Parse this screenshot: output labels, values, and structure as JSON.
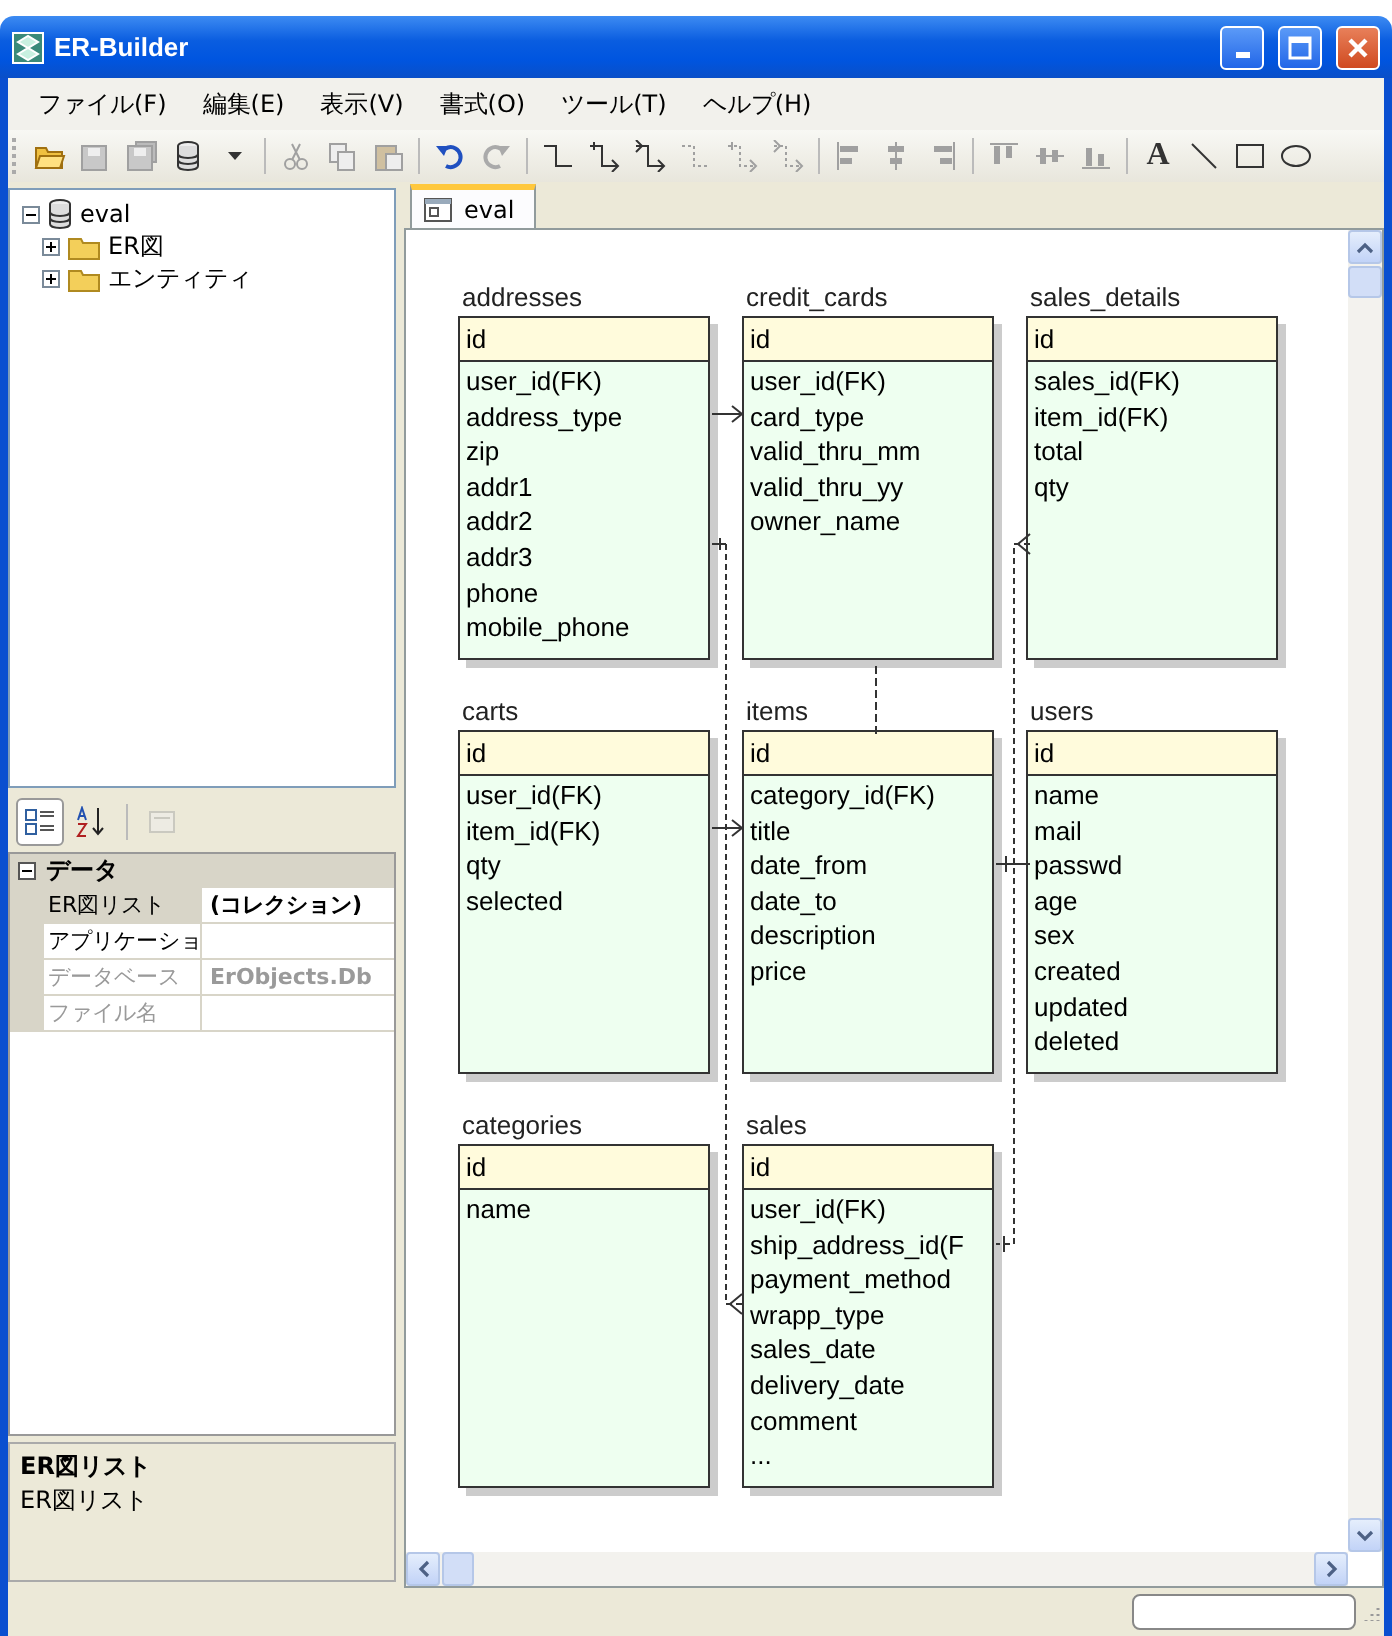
{
  "window": {
    "title": "ER-Builder"
  },
  "menu": [
    "ファイル(F)",
    "編集(E)",
    "表示(V)",
    "書式(O)",
    "ツール(T)",
    "ヘルプ(H)"
  ],
  "toolbar": [
    {
      "kind": "open",
      "disabled": false
    },
    {
      "kind": "save",
      "disabled": true
    },
    {
      "kind": "save-all",
      "disabled": true
    },
    {
      "kind": "database",
      "disabled": false
    },
    {
      "kind": "dropdown",
      "disabled": false
    },
    {
      "kind": "sep"
    },
    {
      "kind": "cut",
      "disabled": true
    },
    {
      "kind": "copy",
      "disabled": true
    },
    {
      "kind": "paste",
      "disabled": true
    },
    {
      "kind": "sep"
    },
    {
      "kind": "undo",
      "disabled": false
    },
    {
      "kind": "redo",
      "disabled": true
    },
    {
      "kind": "sep"
    },
    {
      "kind": "connector",
      "disabled": false
    },
    {
      "kind": "connector-many",
      "disabled": false
    },
    {
      "kind": "connector-arrow",
      "disabled": false
    },
    {
      "kind": "connector",
      "disabled": true
    },
    {
      "kind": "connector-many",
      "disabled": true
    },
    {
      "kind": "connector-arrow",
      "disabled": true
    },
    {
      "kind": "sep"
    },
    {
      "kind": "align-left",
      "disabled": true
    },
    {
      "kind": "align-center",
      "disabled": true
    },
    {
      "kind": "align-right",
      "disabled": true
    },
    {
      "kind": "sep"
    },
    {
      "kind": "align-top",
      "disabled": true
    },
    {
      "kind": "align-middle",
      "disabled": true
    },
    {
      "kind": "align-bottom",
      "disabled": true
    },
    {
      "kind": "sep"
    },
    {
      "kind": "text",
      "label": "A",
      "disabled": false
    },
    {
      "kind": "line",
      "disabled": false
    },
    {
      "kind": "rectangle",
      "disabled": false
    },
    {
      "kind": "ellipse",
      "disabled": false
    }
  ],
  "tree": [
    {
      "label": "eval",
      "expanded": true,
      "children": [
        {
          "label": "ER図",
          "expanded": false
        },
        {
          "label": "エンティティ",
          "expanded": false
        }
      ]
    }
  ],
  "property_toolbar": [
    {
      "kind": "categorized",
      "selected": true,
      "disabled": false
    },
    {
      "kind": "alphabetical",
      "selected": false,
      "disabled": false
    },
    {
      "kind": "pages",
      "selected": false,
      "disabled": true
    }
  ],
  "properties": {
    "category": "データ",
    "expanded": true,
    "rows": [
      {
        "name": "ER図リスト",
        "value": "(コレクション)",
        "disabled": false,
        "bold": true
      },
      {
        "name": "アプリケーショ",
        "disabled": false,
        "bold": false
      },
      {
        "name": "データベース",
        "value": "ErObjects.Db",
        "disabled": true,
        "bold": true
      },
      {
        "name": "ファイル名",
        "disabled": true,
        "bold": false
      }
    ]
  },
  "description": {
    "title": "ER図リスト",
    "text": "ER図リスト"
  },
  "tabs": [
    {
      "label": "eval",
      "selected": true
    }
  ],
  "entities": [
    {
      "name": "addresses",
      "key": "id",
      "columns": [
        "user_id(FK)",
        "address_type",
        "zip",
        "addr1",
        "addr2",
        "addr3",
        "phone",
        "mobile_phone"
      ]
    },
    {
      "name": "credit_cards",
      "key": "id",
      "columns": [
        "user_id(FK)",
        "card_type",
        "valid_thru_mm",
        "valid_thru_yy",
        "owner_name"
      ]
    },
    {
      "name": "sales_details",
      "key": "id",
      "columns": [
        "sales_id(FK)",
        "item_id(FK)",
        "total",
        "qty"
      ]
    },
    {
      "name": "carts",
      "key": "id",
      "columns": [
        "user_id(FK)",
        "item_id(FK)",
        "qty",
        "selected"
      ]
    },
    {
      "name": "items",
      "key": "id",
      "columns": [
        "category_id(FK)",
        "title",
        "date_from",
        "date_to",
        "description",
        "price"
      ]
    },
    {
      "name": "users",
      "key": "id",
      "columns": [
        "name",
        "mail",
        "passwd",
        "age",
        "sex",
        "created",
        "updated",
        "deleted"
      ]
    },
    {
      "name": "categories",
      "key": "id",
      "columns": [
        "name"
      ]
    },
    {
      "name": "sales",
      "key": "id",
      "columns": [
        "user_id(FK)",
        "ship_address_id(F",
        "payment_method",
        "wrapp_type",
        "sales_date",
        "delivery_date",
        "comment",
        "..."
      ]
    }
  ]
}
